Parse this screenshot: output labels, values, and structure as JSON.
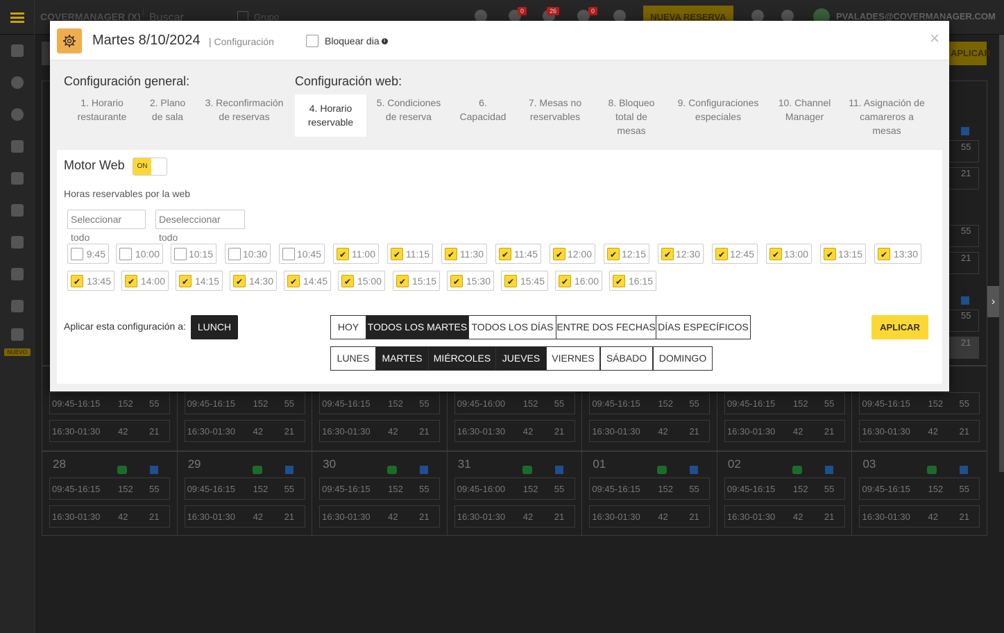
{
  "topbar": {
    "brand": "COVERMANAGER (X)",
    "search_placeholder": "Buscar",
    "grupo_label": "Grupo",
    "badges": [
      "0",
      "26",
      "0"
    ],
    "new_reservation": "NUEVA RESERVA",
    "user_email": "PVALADES@COVERMANAGER.COM"
  },
  "sidebar": {
    "nuevo_badge": "NUEVO"
  },
  "background": {
    "apply_button": "APLICAR",
    "right_column": [
      "55",
      "21",
      "55",
      "21",
      "55",
      "21"
    ],
    "week_upper": [
      {
        "slot1": "09:45-16:15",
        "a1": "152",
        "b1": "55",
        "slot2": "16:30-01:30",
        "a2": "42",
        "b2": "21"
      },
      {
        "slot1": "09:45-16:15",
        "a1": "152",
        "b1": "55",
        "slot2": "16:30-01:30",
        "a2": "42",
        "b2": "21"
      },
      {
        "slot1": "09:45-16:15",
        "a1": "152",
        "b1": "55",
        "slot2": "16:30-01:30",
        "a2": "42",
        "b2": "21"
      },
      {
        "slot1": "09:45-16:00",
        "a1": "152",
        "b1": "55",
        "slot2": "16:30-01:30",
        "a2": "42",
        "b2": "21"
      },
      {
        "slot1": "09:45-16:15",
        "a1": "152",
        "b1": "55",
        "slot2": "16:30-01:30",
        "a2": "42",
        "b2": "21"
      },
      {
        "slot1": "09:45-16:15",
        "a1": "152",
        "b1": "55",
        "slot2": "16:30-01:30",
        "a2": "42",
        "b2": "21"
      },
      {
        "slot1": "09:45-16:15",
        "a1": "152",
        "b1": "55",
        "slot2": "16:30-01:30",
        "a2": "42",
        "b2": "21"
      }
    ],
    "week_lower": [
      {
        "num": "28",
        "slot1": "09:45-16:15",
        "a1": "152",
        "b1": "55",
        "slot2": "16:30-01:30",
        "a2": "42",
        "b2": "21"
      },
      {
        "num": "29",
        "slot1": "09:45-16:15",
        "a1": "152",
        "b1": "55",
        "slot2": "16:30-01:30",
        "a2": "42",
        "b2": "21"
      },
      {
        "num": "30",
        "slot1": "09:45-16:15",
        "a1": "152",
        "b1": "55",
        "slot2": "16:30-01:30",
        "a2": "42",
        "b2": "21"
      },
      {
        "num": "31",
        "slot1": "09:45-16:00",
        "a1": "152",
        "b1": "55",
        "slot2": "16:30-01:30",
        "a2": "42",
        "b2": "21"
      },
      {
        "num": "01",
        "slot1": "09:45-16:15",
        "a1": "152",
        "b1": "55",
        "slot2": "16:30-01:30",
        "a2": "42",
        "b2": "21"
      },
      {
        "num": "02",
        "slot1": "09:45-16:15",
        "a1": "152",
        "b1": "55",
        "slot2": "16:30-01:30",
        "a2": "42",
        "b2": "21"
      },
      {
        "num": "03",
        "slot1": "09:45-16:15",
        "a1": "152",
        "b1": "55",
        "slot2": "16:30-01:30",
        "a2": "42",
        "b2": "21"
      }
    ]
  },
  "modal": {
    "title": "Martes 8/10/2024",
    "subtitle": "| Configuración",
    "block_day_label": "Bloquear dia",
    "close": "×",
    "general_heading": "Configuración general:",
    "web_heading": "Configuración web:",
    "tabs": [
      {
        "l1": "1. Horario",
        "l2": "restaurante",
        "l3": ""
      },
      {
        "l1": "2. Plano",
        "l2": "de sala",
        "l3": ""
      },
      {
        "l1": "3. Reconfirmación",
        "l2": "de reservas",
        "l3": ""
      },
      {
        "l1": "4. Horario",
        "l2": "reservable",
        "l3": ""
      },
      {
        "l1": "5. Condiciones",
        "l2": "de reserva",
        "l3": ""
      },
      {
        "l1": "6.",
        "l2": "Capacidad",
        "l3": ""
      },
      {
        "l1": "7. Mesas no",
        "l2": "reservables",
        "l3": ""
      },
      {
        "l1": "8. Bloqueo",
        "l2": "total de",
        "l3": "mesas"
      },
      {
        "l1": "9. Configuraciones",
        "l2": "especiales",
        "l3": ""
      },
      {
        "l1": "10. Channel",
        "l2": "Manager",
        "l3": ""
      },
      {
        "l1": "11. Asignación de",
        "l2": "camareros a",
        "l3": "mesas"
      }
    ],
    "motor_web_label": "Motor Web",
    "toggle_label": "ON",
    "hours_label": "Horas reservables por la web",
    "select_all": "Seleccionar todo",
    "deselect_all": "Deseleccionar todo",
    "hours": [
      {
        "t": "9:45",
        "on": false
      },
      {
        "t": "10:00",
        "on": false
      },
      {
        "t": "10:15",
        "on": false
      },
      {
        "t": "10:30",
        "on": false
      },
      {
        "t": "10:45",
        "on": false
      },
      {
        "t": "11:00",
        "on": true
      },
      {
        "t": "11:15",
        "on": true
      },
      {
        "t": "11:30",
        "on": true
      },
      {
        "t": "11:45",
        "on": true
      },
      {
        "t": "12:00",
        "on": true
      },
      {
        "t": "12:15",
        "on": true
      },
      {
        "t": "12:30",
        "on": true
      },
      {
        "t": "12:45",
        "on": true
      },
      {
        "t": "13:00",
        "on": true
      },
      {
        "t": "13:15",
        "on": true
      },
      {
        "t": "13:30",
        "on": true
      },
      {
        "t": "13:45",
        "on": true
      },
      {
        "t": "14:00",
        "on": true
      },
      {
        "t": "14:15",
        "on": true
      },
      {
        "t": "14:30",
        "on": true
      },
      {
        "t": "14:45",
        "on": true
      },
      {
        "t": "15:00",
        "on": true
      },
      {
        "t": "15:15",
        "on": true
      },
      {
        "t": "15:30",
        "on": true
      },
      {
        "t": "15:45",
        "on": true
      },
      {
        "t": "16:00",
        "on": true
      },
      {
        "t": "16:15",
        "on": true
      }
    ],
    "apply_to_label": "Aplicar esta configuración a:",
    "lunch": "LUNCH",
    "range_options": [
      {
        "label": "HOY",
        "active": false
      },
      {
        "label": "TODOS LOS MARTES",
        "active": true
      },
      {
        "label": "TODOS LOS DÍAS",
        "active": false
      },
      {
        "label": "ENTRE DOS FECHAS",
        "active": false
      },
      {
        "label": "DÍAS ESPECÍFICOS",
        "active": false
      }
    ],
    "weekdays": [
      {
        "label": "LUNES",
        "active": false
      },
      {
        "label": "MARTES",
        "active": true
      },
      {
        "label": "MIÉRCOLES",
        "active": true
      },
      {
        "label": "JUEVES",
        "active": true
      },
      {
        "label": "VIERNES",
        "active": false
      },
      {
        "label": "SÁBADO",
        "active": false
      },
      {
        "label": "DOMINGO",
        "active": false
      }
    ],
    "apply_button": "APLICAR"
  },
  "colors": {
    "accent_yellow": "#fdd835",
    "gear_orange": "#f0ad4e",
    "dark_button": "#222222"
  }
}
